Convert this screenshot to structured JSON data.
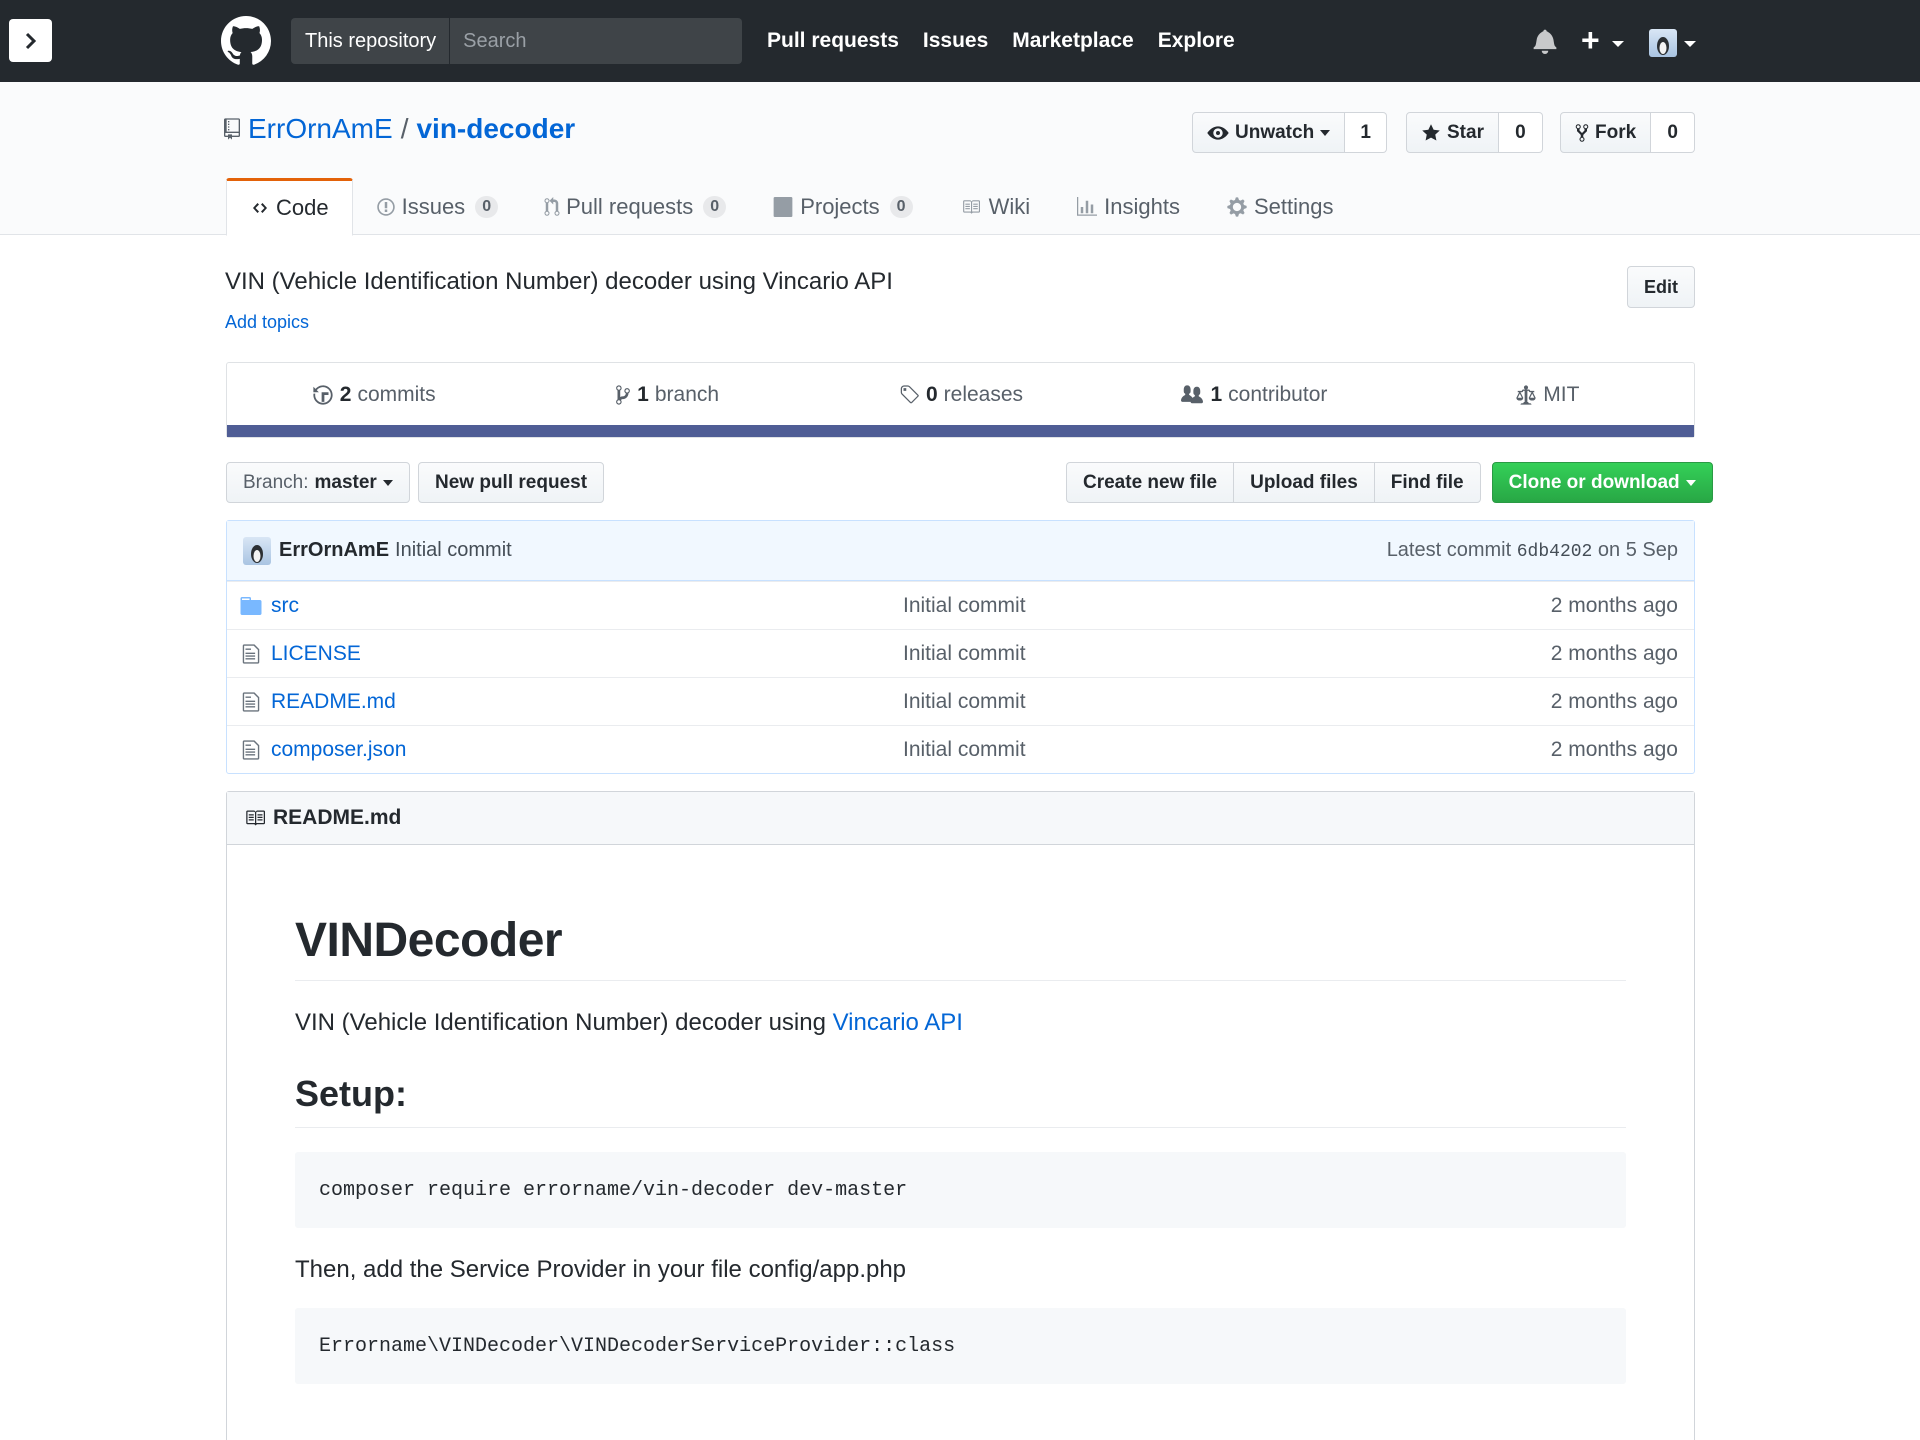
{
  "header": {
    "scope_label": "This repository",
    "search_placeholder": "Search",
    "nav": [
      "Pull requests",
      "Issues",
      "Marketplace",
      "Explore"
    ],
    "plus_label": "+"
  },
  "repo": {
    "owner": "ErrOrnAmE",
    "separator": "/",
    "name": "vin-decoder",
    "watch": {
      "label": "Unwatch",
      "count": "1"
    },
    "star": {
      "label": "Star",
      "count": "0"
    },
    "fork": {
      "label": "Fork",
      "count": "0"
    }
  },
  "tabs": [
    {
      "label": "Code",
      "icon": "code-icon"
    },
    {
      "label": "Issues",
      "count": "0",
      "icon": "issue-icon"
    },
    {
      "label": "Pull requests",
      "count": "0",
      "icon": "git-pull-request-icon"
    },
    {
      "label": "Projects",
      "count": "0",
      "icon": "project-icon"
    },
    {
      "label": "Wiki",
      "icon": "book-icon"
    },
    {
      "label": "Insights",
      "icon": "graph-icon"
    },
    {
      "label": "Settings",
      "icon": "gear-icon"
    }
  ],
  "description": "VIN (Vehicle Identification Number) decoder using Vincario API",
  "add_topics": "Add topics",
  "edit_label": "Edit",
  "summary": {
    "commits": {
      "count": "2",
      "label": "commits"
    },
    "branches": {
      "count": "1",
      "label": "branch"
    },
    "releases": {
      "count": "0",
      "label": "releases"
    },
    "contributors": {
      "count": "1",
      "label": "contributor"
    },
    "license": "MIT",
    "language_color": "#4f5d95"
  },
  "toolbar": {
    "branch_prefix": "Branch:",
    "branch_name": "master",
    "new_pr": "New pull request",
    "create_file": "Create new file",
    "upload_files": "Upload files",
    "find_file": "Find file",
    "clone": "Clone or download"
  },
  "latest_commit": {
    "author": "ErrOrnAmE",
    "message": "Initial commit",
    "prefix": "Latest commit",
    "sha": "6db4202",
    "date": "on 5 Sep"
  },
  "files": [
    {
      "name": "src",
      "type": "directory",
      "message": "Initial commit",
      "age": "2 months ago"
    },
    {
      "name": "LICENSE",
      "type": "file",
      "message": "Initial commit",
      "age": "2 months ago"
    },
    {
      "name": "README.md",
      "type": "file",
      "message": "Initial commit",
      "age": "2 months ago"
    },
    {
      "name": "composer.json",
      "type": "file",
      "message": "Initial commit",
      "age": "2 months ago"
    }
  ],
  "readme": {
    "filename": "README.md",
    "title": "VINDecoder",
    "intro_text": "VIN (Vehicle Identification Number) decoder using ",
    "intro_link": "Vincario API",
    "setup_heading": "Setup:",
    "code1": "composer require errorname/vin-decoder dev-master",
    "text2": "Then, add the Service Provider in your file config/app.php",
    "code2": "Errorname\\VINDecoder\\VINDecoderServiceProvider::class"
  },
  "colors": {
    "header_bg": "#24292e",
    "link": "#0366d6",
    "tab_accent": "#e36209",
    "clone_green": "#28a745"
  }
}
